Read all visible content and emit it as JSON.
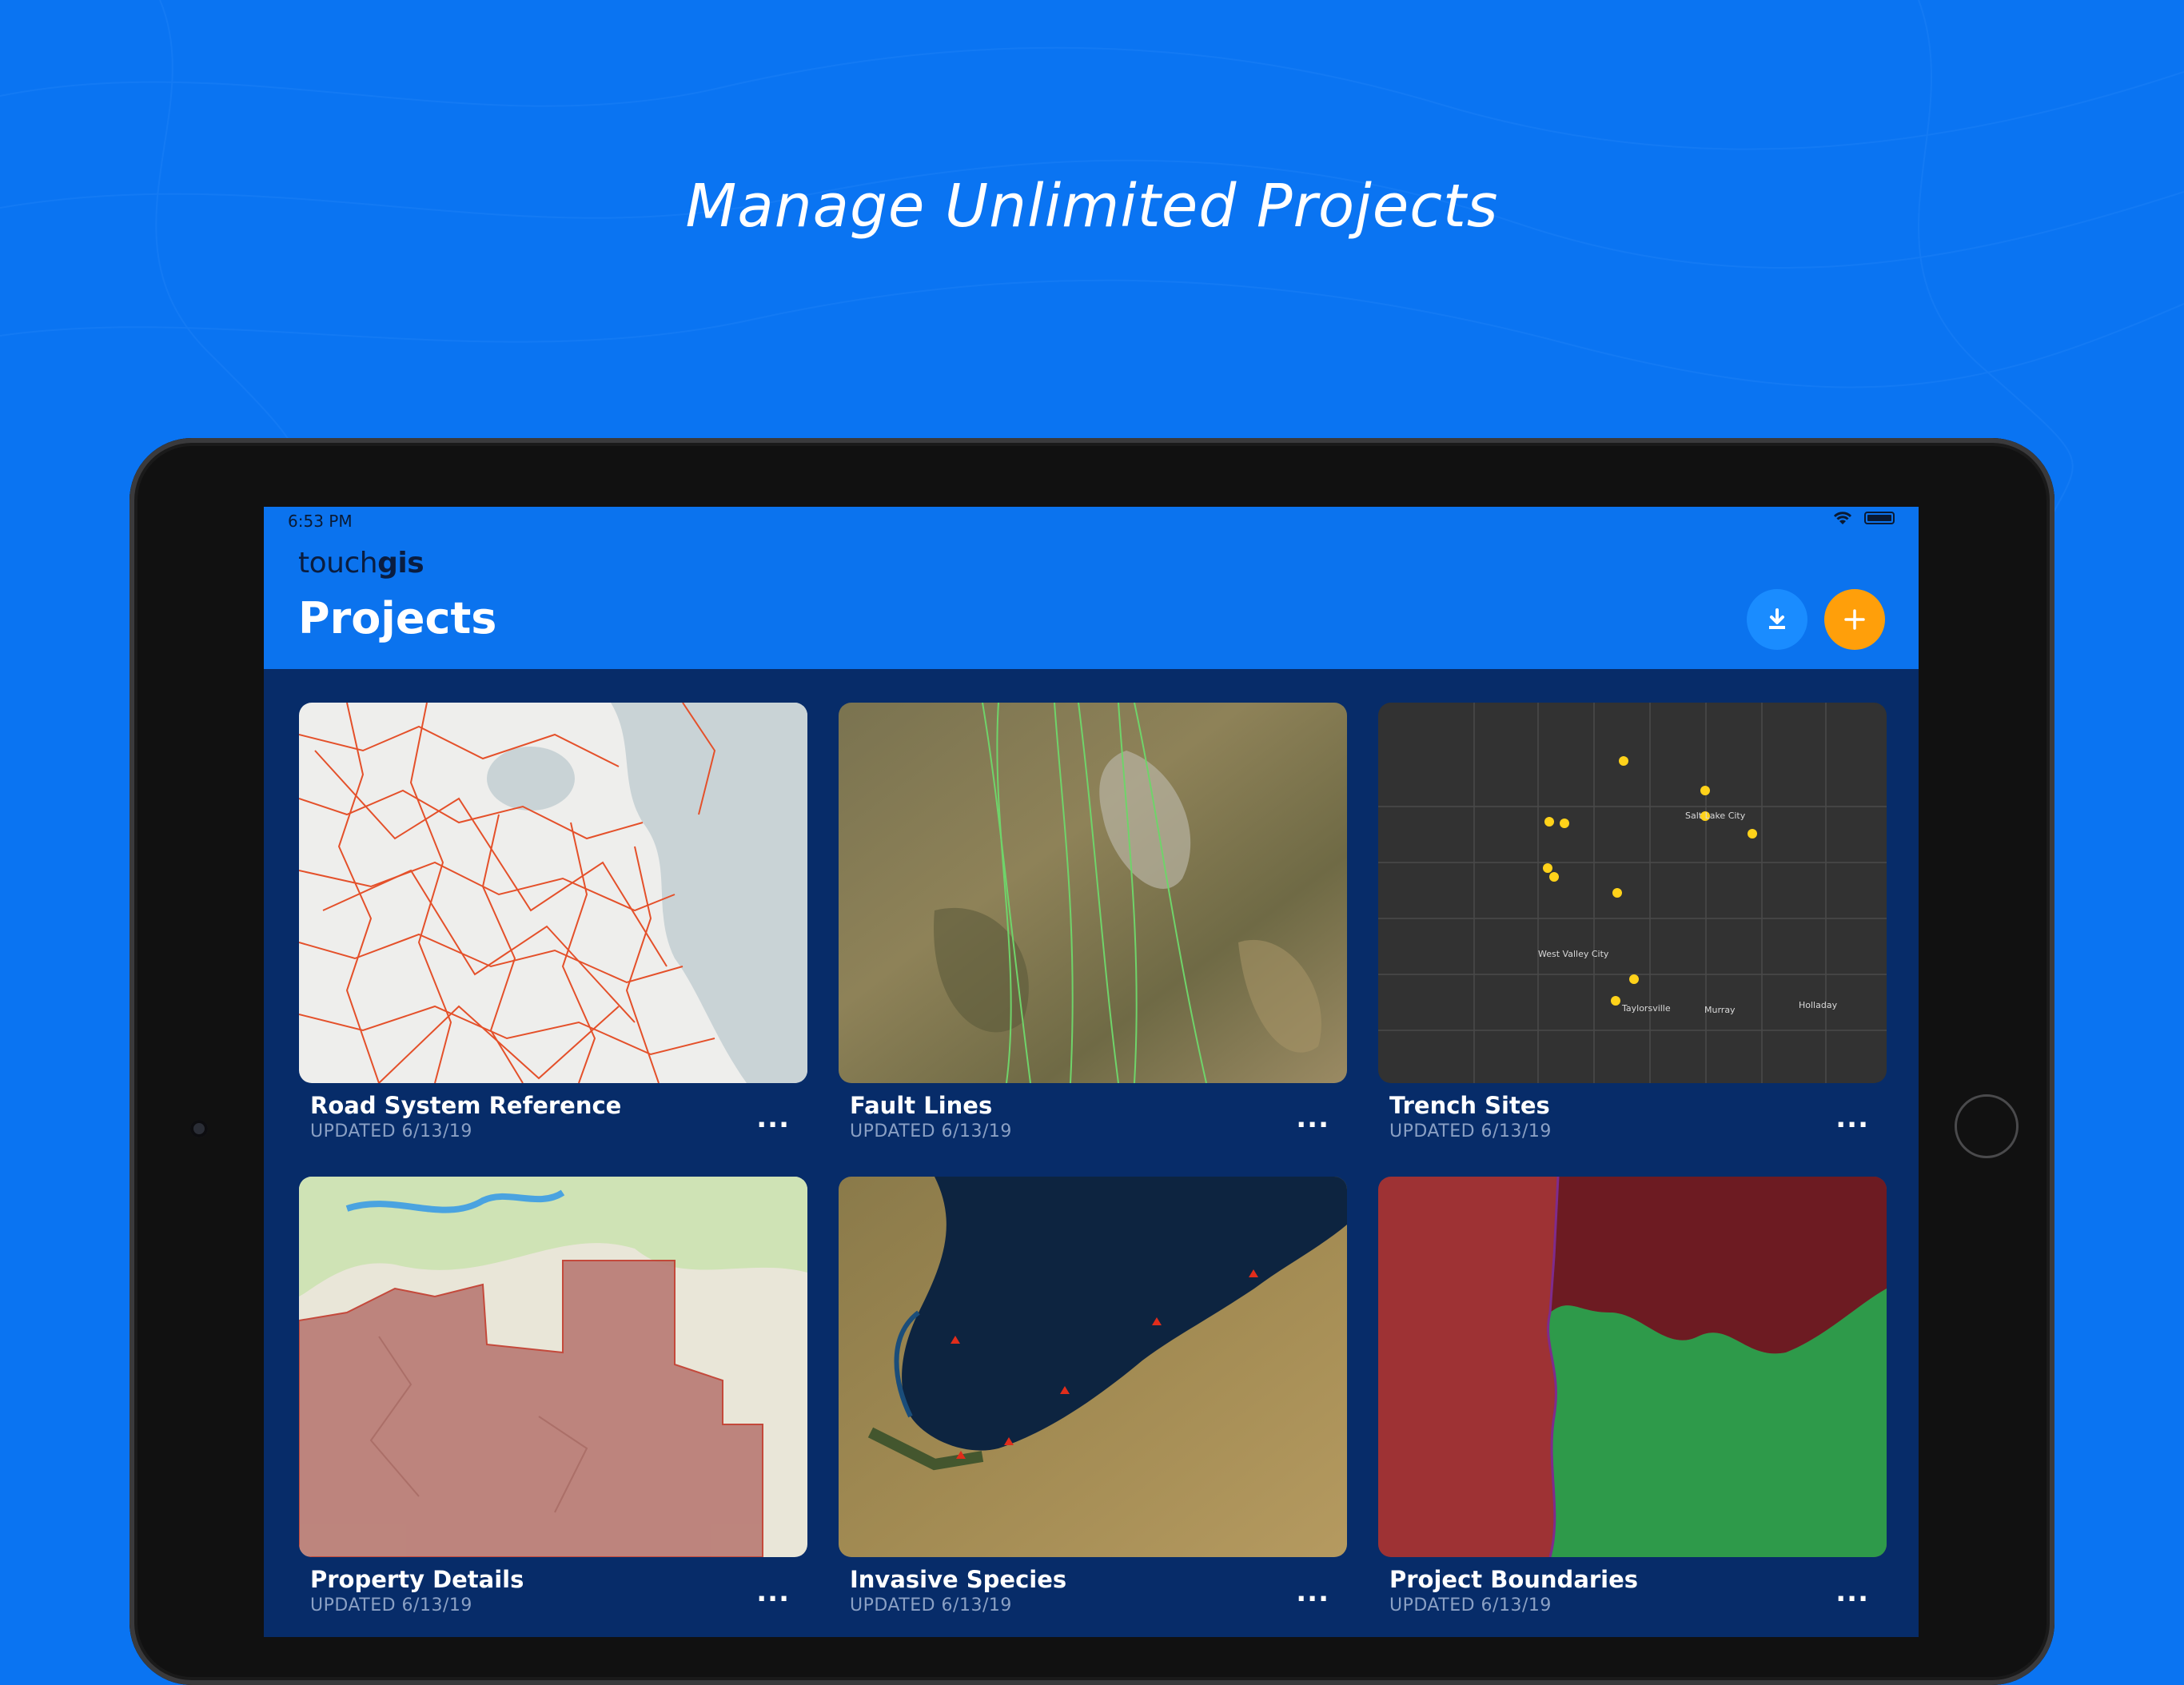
{
  "headline": "Manage Unlimited Projects",
  "status": {
    "time": "6:53 PM"
  },
  "app": {
    "logo_light": "touch",
    "logo_bold": "gis",
    "title": "Projects"
  },
  "actions": {
    "download_icon": "download-icon",
    "add_icon": "plus-icon",
    "add_color": "#ff9f0a"
  },
  "projects": [
    {
      "title": "Road System Reference",
      "updated": "UPDATED 6/13/19",
      "more": "...",
      "map": "road-map"
    },
    {
      "title": "Fault Lines",
      "updated": "UPDATED 6/13/19",
      "more": "...",
      "map": "satellite"
    },
    {
      "title": "Trench Sites",
      "updated": "UPDATED 6/13/19",
      "more": "...",
      "map": "dark-city",
      "map_labels": [
        "Salt Lake City",
        "West Valley City",
        "Taylorsville",
        "Murray",
        "Holladay"
      ]
    },
    {
      "title": "Property Details",
      "updated": "UPDATED 6/13/19",
      "more": "...",
      "map": "terrain"
    },
    {
      "title": "Invasive Species",
      "updated": "UPDATED 6/13/19",
      "more": "...",
      "map": "lake-satellite"
    },
    {
      "title": "Project Boundaries",
      "updated": "UPDATED 6/13/19",
      "more": "...",
      "map": "zones"
    }
  ],
  "colors": {
    "background": "#0a74f2",
    "appbar": "#0b73ee",
    "content": "#072c69"
  }
}
